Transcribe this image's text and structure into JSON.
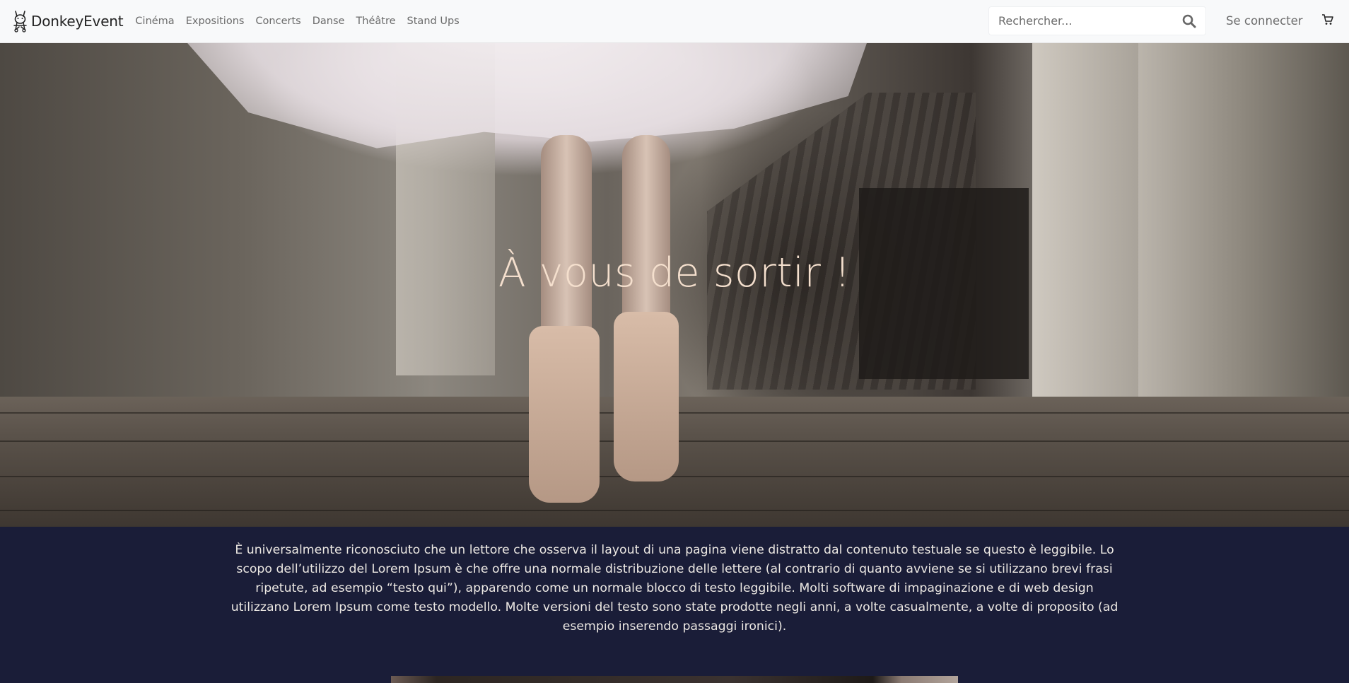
{
  "navbar": {
    "brand": "DonkeyEvent",
    "links": [
      "Cinéma",
      "Expositions",
      "Concerts",
      "Danse",
      "Théâtre",
      "Stand Ups"
    ],
    "search_placeholder": "Rechercher...",
    "login_label": "Se connecter",
    "icons": {
      "logo": "donkey-logo-icon",
      "search": "search-icon",
      "cart": "cart-icon"
    }
  },
  "hero": {
    "title": "À vous de sortir !"
  },
  "intro": {
    "text": "È universalmente riconosciuto che un lettore che osserva il layout di una pagina viene distratto dal contenuto testuale se questo è leggibile. Lo scopo dell’utilizzo del Lorem Ipsum è che offre una normale distribuzione delle lettere (al contrario di quanto avviene se si utilizzano brevi frasi ripetute, ad esempio “testo qui”), apparendo come un normale blocco di testo leggibile. Molti software di impaginazione e di web design utilizzano Lorem Ipsum come testo modello. Molte versioni del testo sono state prodotte negli anni, a volte casualmente, a volte di proposito (ad esempio inserendo passaggi ironici)."
  },
  "colors": {
    "navbar_bg": "#f8f9fa",
    "hero_title": "#f4dfcd",
    "content_bg": "#1a1d38",
    "content_text": "#ece8e3"
  }
}
